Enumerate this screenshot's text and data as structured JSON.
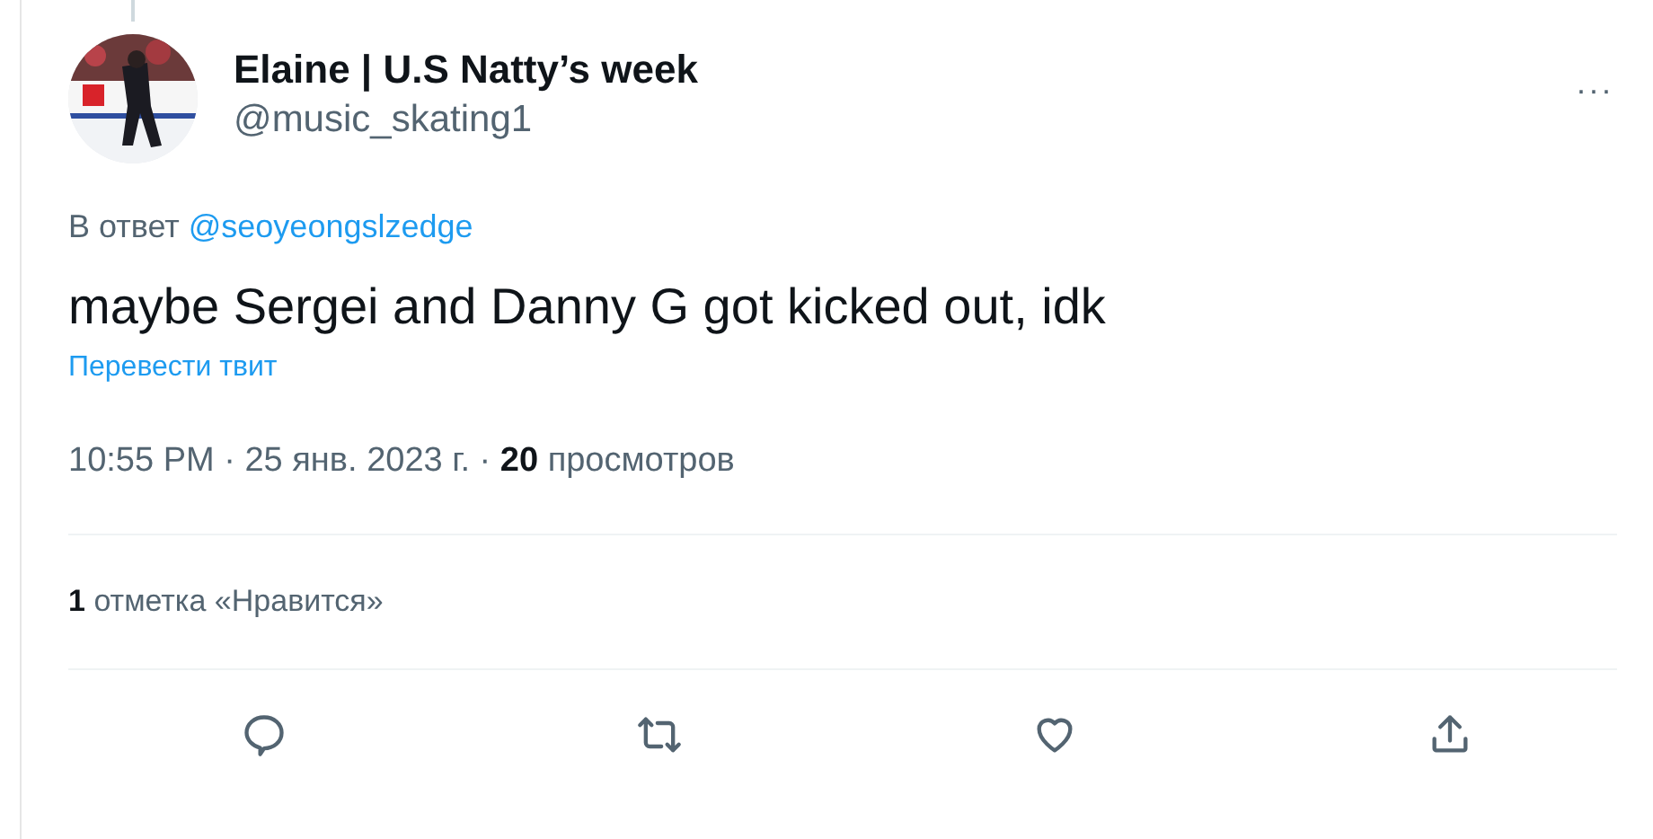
{
  "author": {
    "name": "Elaine | U.S Natty’s week",
    "handle": "@music_skating1"
  },
  "more_button": "···",
  "reply_to": {
    "label": "В ответ",
    "mention": "@seoyeongslzedge"
  },
  "text": "maybe Sergei and Danny G got kicked out, idk",
  "translate_link": "Перевести твит",
  "meta": {
    "separator": "·",
    "time": "10:55 PM",
    "date": "25 янв. 2023 г.",
    "views_count": "20",
    "views_label": "просмотров"
  },
  "likes": {
    "count": "1",
    "label": "отметка «Нравится»"
  },
  "actions": [
    {
      "kind": "reply"
    },
    {
      "kind": "retweet"
    },
    {
      "kind": "like"
    },
    {
      "kind": "share"
    }
  ]
}
